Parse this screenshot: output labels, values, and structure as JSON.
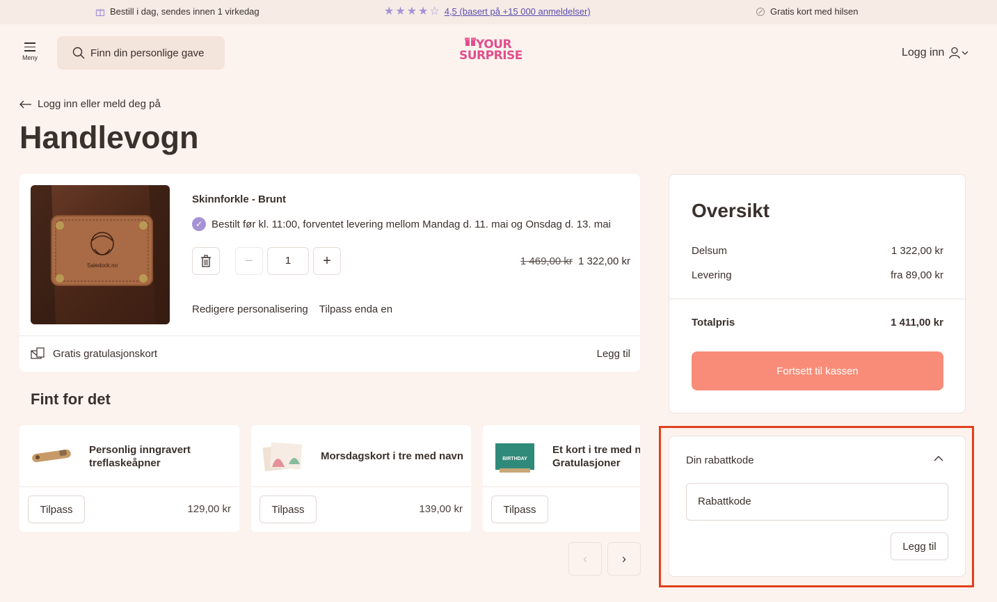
{
  "topbar": {
    "shipping": "Bestill i dag, sendes innen 1 virkedag",
    "rating": "4,5 (basert på +15 000 anmeldelser)",
    "card": "Gratis kort med hilsen"
  },
  "header": {
    "menu_label": "Meny",
    "search_placeholder": "Finn din personlige gave",
    "logo_line1": "YOUR",
    "logo_line2": "SURPRISE",
    "login": "Logg inn"
  },
  "back_link": "Logg inn eller meld deg på",
  "page_title": "Handlevogn",
  "cart_item": {
    "name": "Skinnforkle - Brunt",
    "delivery": "Bestilt før kl. 11:00, forventet levering mellom Mandag d. 11. mai og Onsdag d. 13. mai",
    "quantity": "1",
    "old_price": "1 469,00 kr",
    "price": "1 322,00 kr",
    "edit_link": "Redigere personalisering",
    "customize_link": "Tilpass enda en",
    "image_text": "Saledock.no"
  },
  "gift_card": {
    "label": "Gratis gratulasjonskort",
    "add": "Legg til"
  },
  "recommendations": {
    "title": "Fint for det",
    "items": [
      {
        "title_line1": "Personlig inngravert",
        "title_line2": "treflaskeåpner",
        "cta": "Tilpass",
        "price": "129,00 kr"
      },
      {
        "title_line1": "Morsdagskort i tre med navn",
        "title_line2": "",
        "cta": "Tilpass",
        "price": "139,00 kr"
      },
      {
        "title_line1": "Et kort i tre med na",
        "title_line2": "Gratulasjoner",
        "cta": "Tilpass",
        "price": ""
      }
    ],
    "thumb3_text": "BIRTHDAY"
  },
  "summary": {
    "title": "Oversikt",
    "subtotal_label": "Delsum",
    "subtotal": "1 322,00 kr",
    "delivery_label": "Levering",
    "delivery": "fra 89,00 kr",
    "total_label": "Totalpris",
    "total": "1 411,00 kr",
    "checkout": "Fortsett til kassen"
  },
  "coupon": {
    "title": "Din rabattkode",
    "placeholder": "Rabattkode",
    "apply": "Legg til"
  },
  "colors": {
    "accent_purple": "#a693d6",
    "checkout_button": "#f98c78",
    "highlight_border": "#e1401b",
    "logo_pink": "#e04e8c"
  }
}
